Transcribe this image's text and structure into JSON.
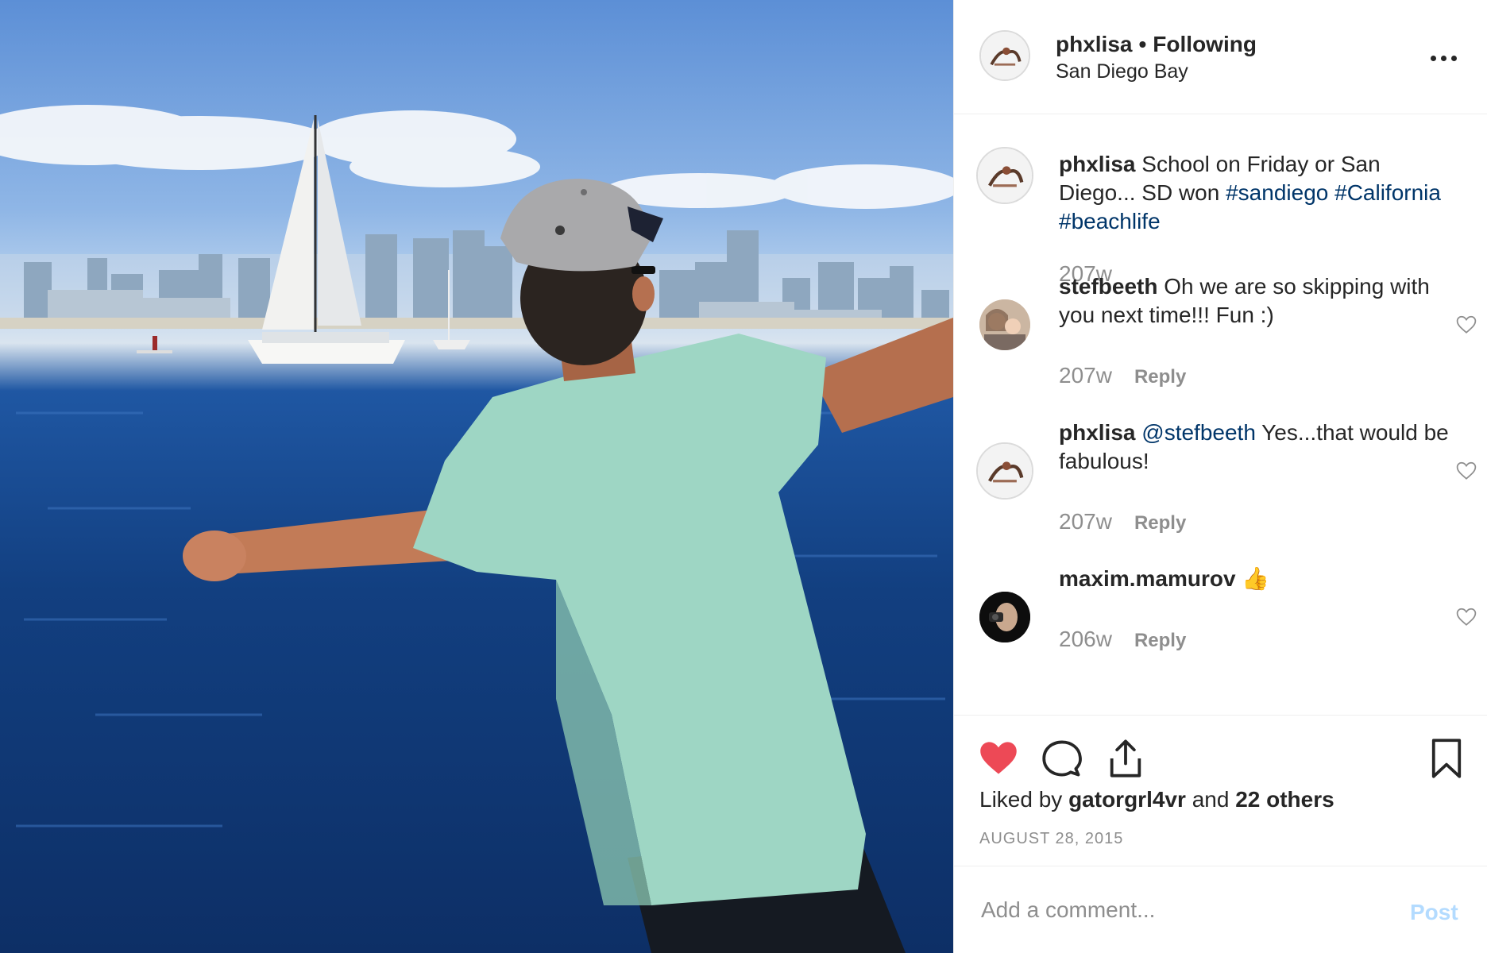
{
  "post": {
    "author": "phxlisa",
    "separator": "•",
    "follow_status": "Following",
    "location": "San Diego Bay",
    "photo_icon": "post-photo-san-diego-bay"
  },
  "caption": {
    "user": "phxlisa",
    "text": "School on Friday or San Diego... SD won",
    "hashtags": [
      "#sandiego",
      "#California",
      "#beachlife"
    ],
    "age": "207w"
  },
  "comments": [
    {
      "user": "stefbeeth",
      "mention": "",
      "text": "Oh we are so skipping with you next time!!! Fun :)",
      "age": "207w",
      "reply_label": "Reply"
    },
    {
      "user": "phxlisa",
      "mention": "@stefbeeth",
      "text": "Yes...that would be fabulous!",
      "age": "207w",
      "reply_label": "Reply"
    },
    {
      "user": "maxim.mamurov",
      "mention": "",
      "text": "👍",
      "age": "206w",
      "reply_label": "Reply"
    }
  ],
  "actions": {
    "liked": true,
    "icons": [
      "heart-filled-icon",
      "comment-icon",
      "share-icon",
      "bookmark-icon"
    ],
    "liked_by_prefix": "Liked by",
    "liked_by_user": "gatorgrl4vr",
    "liked_by_and": "and",
    "liked_by_others": "22 others",
    "date": "AUGUST 28, 2015"
  },
  "add_comment": {
    "placeholder": "Add a comment...",
    "post_label": "Post"
  },
  "colors": {
    "like_red": "#ed4956",
    "hashtag_blue": "#003569",
    "post_disabled": "#b3dbff",
    "muted_gray": "#8e8e8e"
  }
}
